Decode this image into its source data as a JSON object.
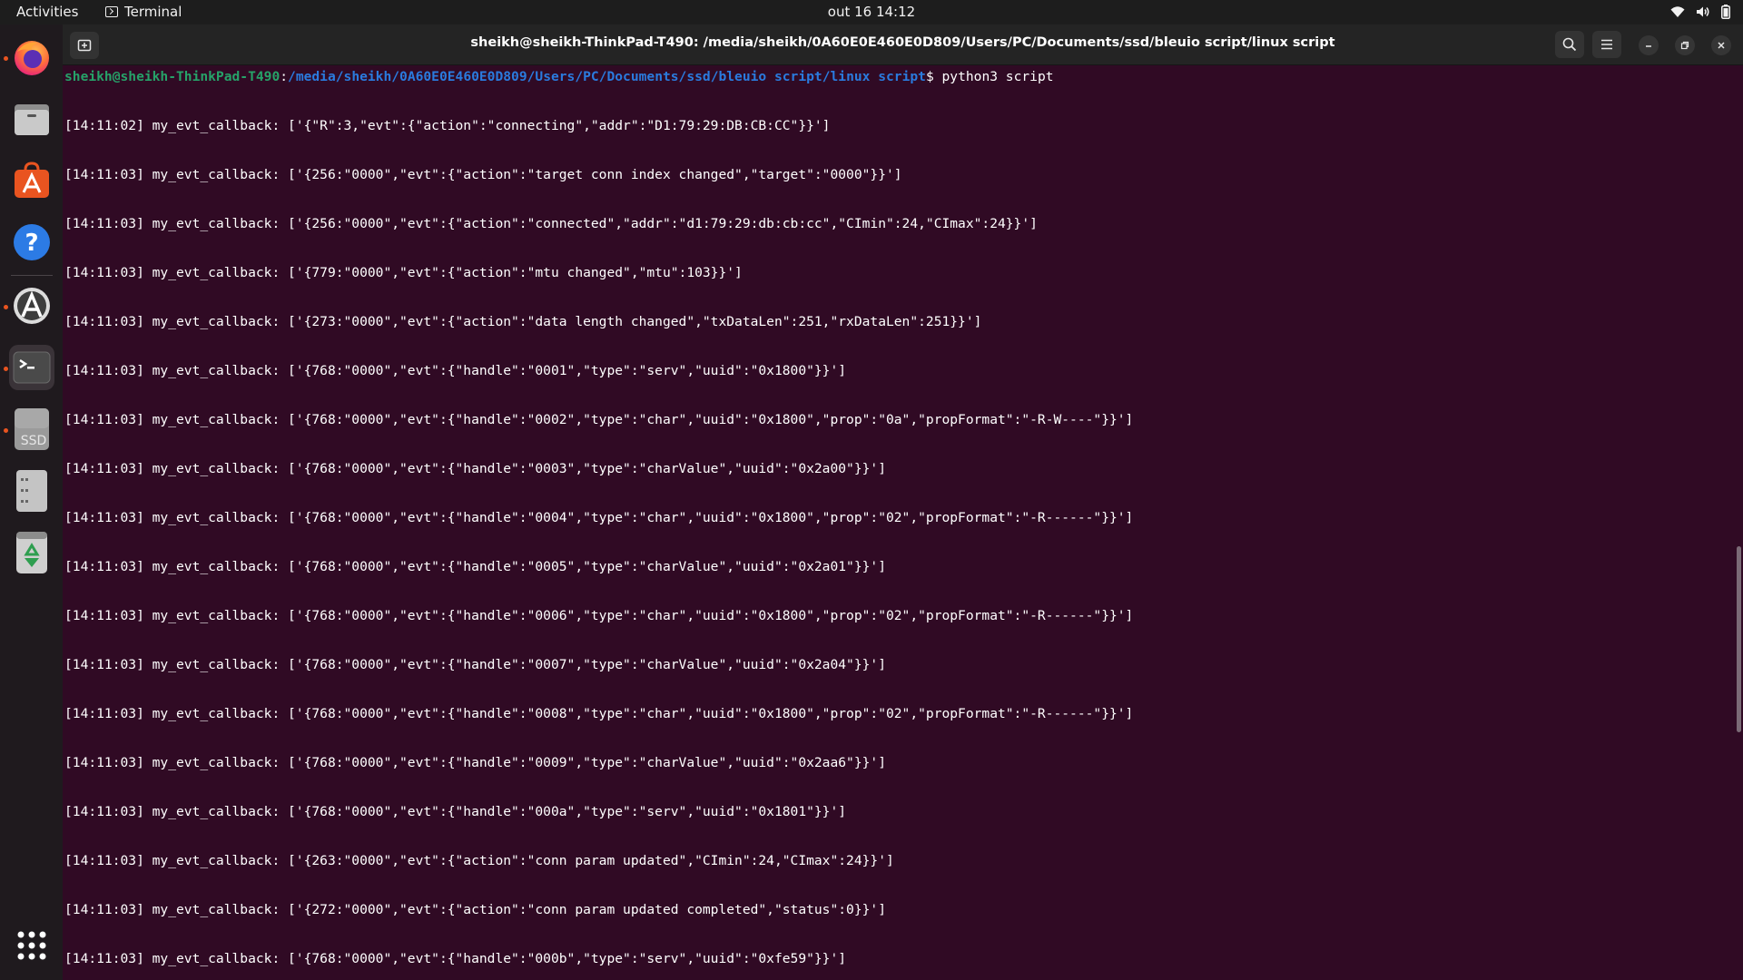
{
  "topbar": {
    "activities": "Activities",
    "app_name": "Terminal",
    "clock": "out 16  14:12"
  },
  "dock": {
    "items": [
      "firefox",
      "files",
      "app-center",
      "help",
      "software-updater",
      "terminal",
      "ssd-drive",
      "usb-drive",
      "trash",
      "show-apps"
    ],
    "ssd_label": "SSD"
  },
  "window": {
    "title": "sheikh@sheikh-ThinkPad-T490: /media/sheikh/0A60E0E460E0D809/Users/PC/Documents/ssd/bleuio script/linux script"
  },
  "terminal": {
    "prompt_user": "sheikh@sheikh-ThinkPad-T490",
    "prompt_colon": ":",
    "prompt_path": "/media/sheikh/0A60E0E460E0D809/Users/PC/Documents/ssd/bleuio script/linux script",
    "prompt_cmd": "$ python3 script",
    "lines": [
      "[14:11:02] my_evt_callback: ['{\"R\":3,\"evt\":{\"action\":\"connecting\",\"addr\":\"D1:79:29:DB:CB:CC\"}}']",
      "[14:11:03] my_evt_callback: ['{256:\"0000\",\"evt\":{\"action\":\"target conn index changed\",\"target\":\"0000\"}}']",
      "[14:11:03] my_evt_callback: ['{256:\"0000\",\"evt\":{\"action\":\"connected\",\"addr\":\"d1:79:29:db:cb:cc\",\"CImin\":24,\"CImax\":24}}']",
      "[14:11:03] my_evt_callback: ['{779:\"0000\",\"evt\":{\"action\":\"mtu changed\",\"mtu\":103}}']",
      "[14:11:03] my_evt_callback: ['{273:\"0000\",\"evt\":{\"action\":\"data length changed\",\"txDataLen\":251,\"rxDataLen\":251}}']",
      "[14:11:03] my_evt_callback: ['{768:\"0000\",\"evt\":{\"handle\":\"0001\",\"type\":\"serv\",\"uuid\":\"0x1800\"}}']",
      "[14:11:03] my_evt_callback: ['{768:\"0000\",\"evt\":{\"handle\":\"0002\",\"type\":\"char\",\"uuid\":\"0x1800\",\"prop\":\"0a\",\"propFormat\":\"-R-W----\"}}']",
      "[14:11:03] my_evt_callback: ['{768:\"0000\",\"evt\":{\"handle\":\"0003\",\"type\":\"charValue\",\"uuid\":\"0x2a00\"}}']",
      "[14:11:03] my_evt_callback: ['{768:\"0000\",\"evt\":{\"handle\":\"0004\",\"type\":\"char\",\"uuid\":\"0x1800\",\"prop\":\"02\",\"propFormat\":\"-R------\"}}']",
      "[14:11:03] my_evt_callback: ['{768:\"0000\",\"evt\":{\"handle\":\"0005\",\"type\":\"charValue\",\"uuid\":\"0x2a01\"}}']",
      "[14:11:03] my_evt_callback: ['{768:\"0000\",\"evt\":{\"handle\":\"0006\",\"type\":\"char\",\"uuid\":\"0x1800\",\"prop\":\"02\",\"propFormat\":\"-R------\"}}']",
      "[14:11:03] my_evt_callback: ['{768:\"0000\",\"evt\":{\"handle\":\"0007\",\"type\":\"charValue\",\"uuid\":\"0x2a04\"}}']",
      "[14:11:03] my_evt_callback: ['{768:\"0000\",\"evt\":{\"handle\":\"0008\",\"type\":\"char\",\"uuid\":\"0x1800\",\"prop\":\"02\",\"propFormat\":\"-R------\"}}']",
      "[14:11:03] my_evt_callback: ['{768:\"0000\",\"evt\":{\"handle\":\"0009\",\"type\":\"charValue\",\"uuid\":\"0x2aa6\"}}']",
      "[14:11:03] my_evt_callback: ['{768:\"0000\",\"evt\":{\"handle\":\"000a\",\"type\":\"serv\",\"uuid\":\"0x1801\"}}']",
      "[14:11:03] my_evt_callback: ['{263:\"0000\",\"evt\":{\"action\":\"conn param updated\",\"CImin\":24,\"CImax\":24}}']",
      "[14:11:03] my_evt_callback: ['{272:\"0000\",\"evt\":{\"action\":\"conn param updated completed\",\"status\":0}}']",
      "[14:11:03] my_evt_callback: ['{768:\"0000\",\"evt\":{\"handle\":\"000b\",\"type\":\"serv\",\"uuid\":\"0xfe59\"}}']"
    ]
  },
  "colors": {
    "terminal_bg": "#300a24",
    "prompt_user": "#26a269",
    "prompt_path": "#2a7bde",
    "accent": "#e95420"
  }
}
